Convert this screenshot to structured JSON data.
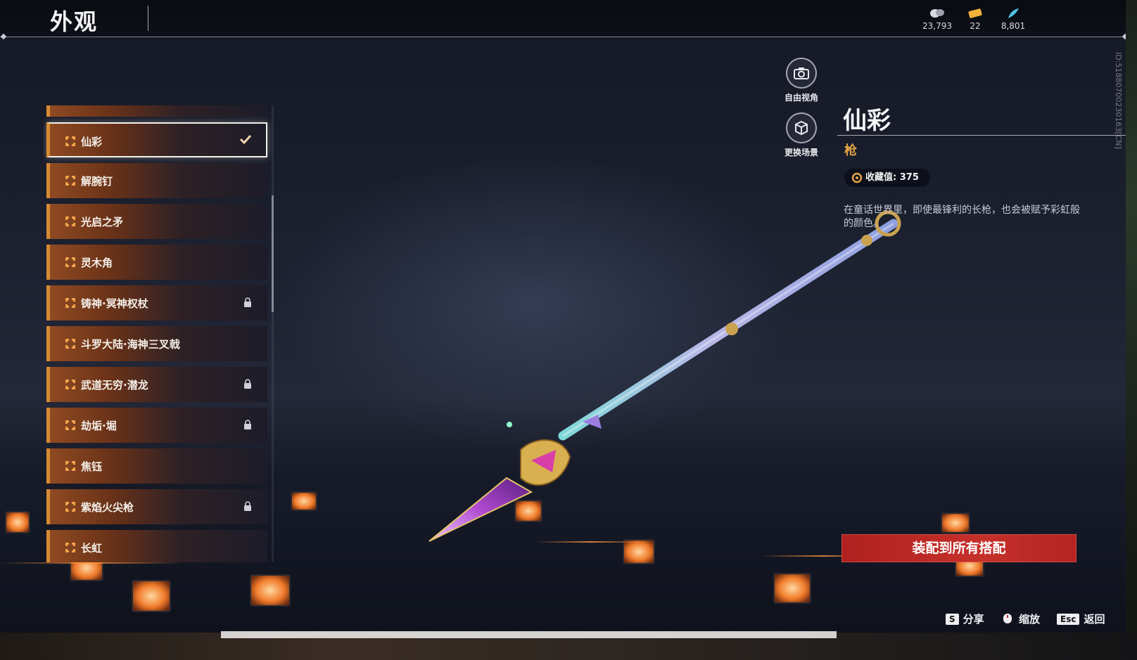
{
  "header": {
    "title": "外观",
    "currencies": [
      {
        "icon": "coin-stack-icon",
        "value": "23,793"
      },
      {
        "icon": "ticket-icon",
        "value": "22"
      },
      {
        "icon": "feather-icon",
        "value": "8,801"
      }
    ]
  },
  "list": {
    "items": [
      {
        "label": "仙彩",
        "selected": true,
        "locked": false
      },
      {
        "label": "解腕钉",
        "selected": false,
        "locked": false
      },
      {
        "label": "光启之矛",
        "selected": false,
        "locked": false
      },
      {
        "label": "灵木角",
        "selected": false,
        "locked": false
      },
      {
        "label": "铸神·冥神权杖",
        "selected": false,
        "locked": true
      },
      {
        "label": "斗罗大陆·海神三叉戟",
        "selected": false,
        "locked": false
      },
      {
        "label": "武道无穷·潜龙",
        "selected": false,
        "locked": true
      },
      {
        "label": "劫垢·堀",
        "selected": false,
        "locked": true
      },
      {
        "label": "焦钰",
        "selected": false,
        "locked": false
      },
      {
        "label": "紫焰火尖枪",
        "selected": false,
        "locked": true
      },
      {
        "label": "长虹",
        "selected": false,
        "locked": false
      }
    ]
  },
  "camera": {
    "free_view_label": "自由视角",
    "change_scene_label": "更换场景"
  },
  "detail": {
    "name": "仙彩",
    "type": "枪",
    "collection_label": "收藏值: 375",
    "description": "在童话世界里，即使最锋利的长枪，也会被赋予彩虹般的颜色。"
  },
  "actions": {
    "equip_all_label": "装配到所有搭配"
  },
  "hints": {
    "share_key": "S",
    "share_label": "分享",
    "zoom_label": "缩放",
    "back_key": "Esc",
    "back_label": "返回"
  },
  "id_text": "ID:5188070023​0163[CN]",
  "colors": {
    "accent_orange": "#d78a33",
    "button_red": "#c6302b",
    "type_gold": "#e3a447"
  }
}
